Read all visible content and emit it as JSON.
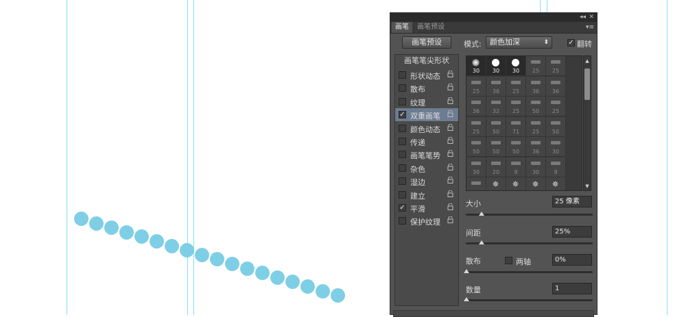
{
  "panel": {
    "tabs": [
      "画笔",
      "画笔预设"
    ],
    "titlebar_collapse": "◂◂",
    "titlebar_close": "✕",
    "menu_icon": "▾≡",
    "preset_button": "画笔预设",
    "mode_label": "模式:",
    "mode_value": "颜色加深",
    "flip_label": "翻转",
    "flip_checked": true
  },
  "options": {
    "header": "画笔笔尖形状",
    "items": [
      {
        "label": "形状动态",
        "checked": false,
        "selected": false
      },
      {
        "label": "散布",
        "checked": false,
        "selected": false
      },
      {
        "label": "纹理",
        "checked": false,
        "selected": false
      },
      {
        "label": "双重画笔",
        "checked": true,
        "selected": true
      },
      {
        "label": "颜色动态",
        "checked": false,
        "selected": false
      },
      {
        "label": "传递",
        "checked": false,
        "selected": false
      },
      {
        "label": "画笔笔势",
        "checked": false,
        "selected": false
      },
      {
        "label": "杂色",
        "checked": false,
        "selected": false
      },
      {
        "label": "湿边",
        "checked": false,
        "selected": false
      },
      {
        "label": "建立",
        "checked": false,
        "selected": false
      },
      {
        "label": "平滑",
        "checked": true,
        "selected": false
      },
      {
        "label": "保护纹理",
        "checked": false,
        "selected": false
      }
    ]
  },
  "brush_grid": {
    "rows": [
      [
        "30",
        "30",
        "30",
        "25",
        "25"
      ],
      [
        "25",
        "36",
        "25",
        "36",
        "36"
      ],
      [
        "36",
        "32",
        "25",
        "50",
        "25"
      ],
      [
        "25",
        "50",
        "71",
        "25",
        "50"
      ],
      [
        "50",
        "50",
        "50",
        "36",
        "30"
      ],
      [
        "30",
        "20",
        "9",
        "30",
        "9"
      ],
      [
        "",
        "",
        "",
        "",
        ""
      ]
    ]
  },
  "settings": {
    "size_label": "大小",
    "size_value": "25 像素",
    "size_level": 0.12,
    "spacing_label": "间距",
    "spacing_value": "25%",
    "spacing_level": 0.12,
    "scatter_label": "散布",
    "both_axes_label": "两轴",
    "both_axes_checked": false,
    "scatter_value": "0%",
    "scatter_level": 0.0,
    "count_label": "数量",
    "count_value": "1",
    "count_level": 0.0
  },
  "icons": {
    "lock": "lock-icon",
    "checkbox_check": "✓",
    "select_arrow": "⬍"
  },
  "colors": {
    "guide": "#7fe3ea",
    "stroke_dot": "#7ecfe6",
    "panel_bg": "#535353",
    "selected_row": "#6c7c92"
  }
}
